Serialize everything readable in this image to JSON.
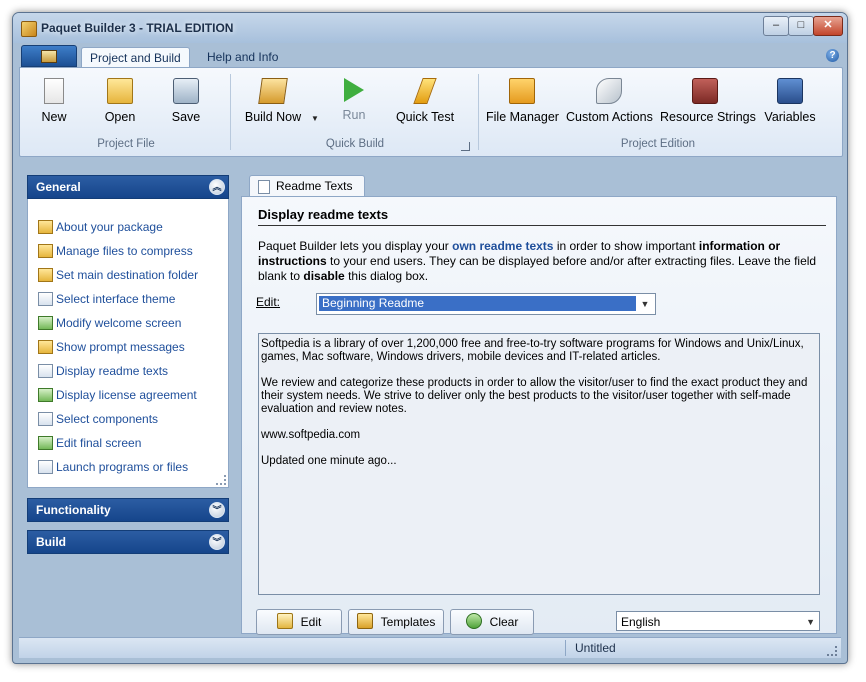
{
  "window": {
    "title": "Paquet Builder 3 - TRIAL EDITION"
  },
  "ribbon_tabs": [
    "Project and Build",
    "Help and Info"
  ],
  "help_label": "?",
  "ribbon": {
    "project_file": {
      "label": "Project File",
      "buttons": [
        "New",
        "Open",
        "Save"
      ]
    },
    "quick_build": {
      "label": "Quick Build",
      "buttons": [
        "Build Now",
        "Run",
        "Quick Test"
      ]
    },
    "project_edition": {
      "label": "Project Edition",
      "buttons": [
        "File Manager",
        "Custom Actions",
        "Resource Strings",
        "Variables"
      ]
    }
  },
  "sidebar": {
    "general": {
      "title": "General",
      "items": [
        "About your package",
        "Manage files to compress",
        "Set main destination folder",
        "Select interface theme",
        "Modify welcome screen",
        "Show prompt messages",
        "Display readme texts",
        "Display license agreement",
        "Select components",
        "Edit final screen",
        "Launch programs or files"
      ]
    },
    "functionality": {
      "title": "Functionality"
    },
    "build": {
      "title": "Build"
    }
  },
  "content": {
    "tab": "Readme Texts",
    "title": "Display readme texts",
    "desc": {
      "p1": "Paquet Builder lets you display your ",
      "hl1": "own readme texts",
      "p2": " in order to show important ",
      "b1": "information or instructions",
      "p3": " to your end users. They can be displayed before and/or after extracting files. Leave the field blank to ",
      "b2": "disable",
      "p4": " this dialog box."
    },
    "edit_label": "Edit:",
    "edit_value": "Beginning Readme",
    "readme_lines": [
      "Softpedia is a library of over 1,200,000 free and free-to-try software programs for Windows and Unix/Linux, games, Mac software, Windows drivers, mobile devices and IT-related articles.",
      "We review and categorize these products in order to allow the visitor/user to find the exact product they and their system needs. We strive to deliver only the best products to the visitor/user together with self-made evaluation and review notes.",
      "www.softpedia.com",
      "Updated one minute ago..."
    ],
    "buttons": {
      "edit": "Edit",
      "templates": "Templates",
      "clear": "Clear"
    },
    "language": "English"
  },
  "status": {
    "text": "Untitled"
  }
}
